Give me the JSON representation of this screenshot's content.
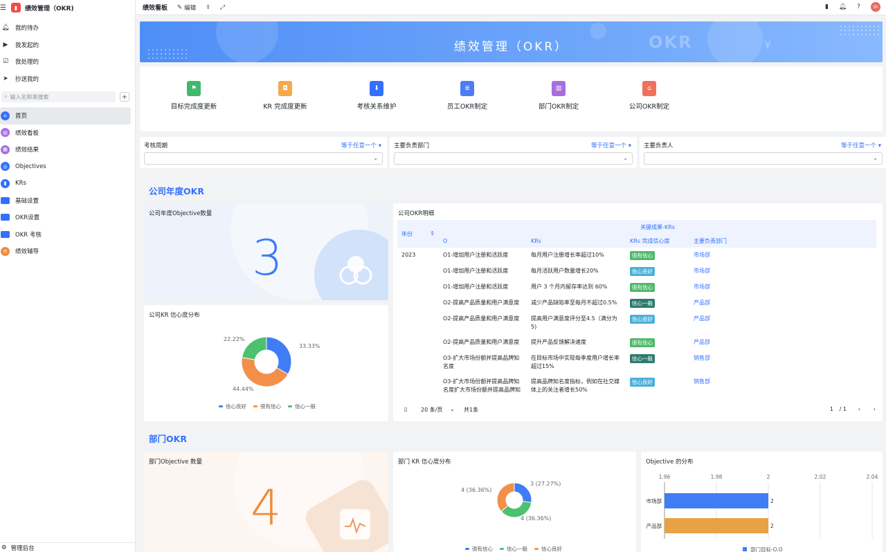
{
  "app": {
    "title": "绩效管理（OKR)",
    "logo_icon": "bookmark-icon"
  },
  "sidebar": {
    "quick": [
      {
        "label": "我的待办",
        "icon": "bell-icon"
      },
      {
        "label": "我发起的",
        "icon": "play-circle-icon"
      },
      {
        "label": "我处理的",
        "icon": "check-square-icon"
      },
      {
        "label": "抄送我的",
        "icon": "send-icon"
      }
    ],
    "search_placeholder": "输入名称来搜索",
    "nav": [
      {
        "label": "首页",
        "icon": "home-icon",
        "color": "#3370ff"
      },
      {
        "label": "绩效看板",
        "icon": "dashboard-icon",
        "color": "#a86ee0"
      },
      {
        "label": "绩效结果",
        "icon": "chart-icon",
        "color": "#a86ee0"
      },
      {
        "label": "Objectives",
        "icon": "target-icon",
        "color": "#3370ff"
      },
      {
        "label": "KRs",
        "icon": "bookmark-icon",
        "color": "#3370ff"
      },
      {
        "label": "基础设置",
        "icon": "folder-icon",
        "color": "#3370ff"
      },
      {
        "label": "OKR设置",
        "icon": "folder-icon",
        "color": "#3370ff"
      },
      {
        "label": "OKR 考核",
        "icon": "folder-icon",
        "color": "#3370ff"
      },
      {
        "label": "绩效辅导",
        "icon": "doc-icon",
        "color": "#f08c3a"
      }
    ],
    "footer": "管理后台"
  },
  "topbar": {
    "title": "绩效看板",
    "edit": "编辑",
    "avatar": "Sh"
  },
  "banner": {
    "title": "绩效管理（OKR）",
    "deco": "OKR"
  },
  "quick_actions": [
    {
      "label": "目标完成度更新",
      "color": "#3fb96b",
      "icon": "flag-icon"
    },
    {
      "label": "KR 完成度更新",
      "color": "#f5a94a",
      "icon": "box-icon"
    },
    {
      "label": "考核关系维护",
      "color": "#3370ff",
      "icon": "download-icon"
    },
    {
      "label": "员工OKR制定",
      "color": "#4c7cf6",
      "icon": "list-icon"
    },
    {
      "label": "部门OKR制定",
      "color": "#a86ee0",
      "icon": "bar-chart-icon"
    },
    {
      "label": "公司OKR制定",
      "color": "#f0715b",
      "icon": "building-icon"
    }
  ],
  "filters": [
    {
      "label": "考核周期",
      "op": "等于任意一个"
    },
    {
      "label": "主要负责部门",
      "op": "等于任意一个"
    },
    {
      "label": "主要负责人",
      "op": "等于任意一个"
    }
  ],
  "company": {
    "section_title": "公司年度OKR",
    "objective_title": "公司年度Objective数量",
    "objective_count": "3",
    "kr_title": "公司KR 信心度分布",
    "table_title": "公司OKR明细",
    "table": {
      "year_header": "年份",
      "group_header": "关键成果-KRs",
      "columns": [
        "O",
        "KRs",
        "KRs 完成信心度",
        "主要负责部门"
      ],
      "year": "2023",
      "rows": [
        {
          "o": "O1-增加用户注册和活跃度",
          "kr": "每月用户注册增长率超过10%",
          "conf": "很有信心",
          "dept": "市场部"
        },
        {
          "o": "O1-增加用户注册和活跃度",
          "kr": "每月活跃用户数量增长20%",
          "conf": "信心良好",
          "dept": "市场部"
        },
        {
          "o": "O1-增加用户注册和活跃度",
          "kr": "用户 3 个月内留存率达到 60%",
          "conf": "很有信心",
          "dept": "市场部"
        },
        {
          "o": "O2-提高产品质量和用户满意度",
          "kr": "减少产品缺陷率至每月不超过0.5%",
          "conf": "信心一般",
          "dept": "产品部"
        },
        {
          "o": "O2-提高产品质量和用户满意度",
          "kr": "提高用户满意度评分至4.5（满分为5)",
          "conf": "信心良好",
          "dept": "产品部"
        },
        {
          "o": "O2-提高产品质量和用户满意度",
          "kr": "提升产品反馈解决速度",
          "conf": "很有信心",
          "dept": "产品部"
        },
        {
          "o": "O3-扩大市场份额并提高品牌知名度",
          "kr": "在目标市场中实现每季度用户增长率超过15%",
          "conf": "信心一般",
          "dept": "销售部"
        },
        {
          "o": "O3-扩大市场份额并提高品牌知名度扩大市场份额并提高品牌知",
          "kr": "提高品牌知名度指标，例如在社交媒体上的关注者增长50%",
          "conf": "信心良好",
          "dept": "销售部"
        }
      ],
      "conf_colors": {
        "很有信心": "#4fb96b",
        "信心良好": "#4ab0d9",
        "信心一般": "#2f7a6e"
      }
    },
    "pager": {
      "page_size": "20 条/页",
      "total": "共1条",
      "page": "1",
      "pages": "/ 1"
    }
  },
  "dept": {
    "section_title": "部门OKR",
    "objective_title": "部门Objective 数量",
    "objective_count": "4",
    "kr_title": "部门 KR 信心度分布",
    "dist_title": "Objective 的分布"
  },
  "chart_data": [
    {
      "type": "pie",
      "title": "公司KR 信心度分布",
      "categories": [
        "信心良好",
        "很有信心",
        "信心一般"
      ],
      "values": [
        33.33,
        44.44,
        22.22
      ],
      "labels": [
        "33.33%",
        "44.44%",
        "22.22%"
      ],
      "colors": [
        "#3f7cf6",
        "#f2904a",
        "#4cc16e"
      ],
      "legend": "bottom"
    },
    {
      "type": "pie",
      "title": "部门 KR 信心度分布",
      "categories": [
        "很有信心",
        "信心一般",
        "信心良好"
      ],
      "legend_colors": [
        "#3f7cf6",
        "#4cc16e",
        "#f2904a"
      ],
      "slices": [
        {
          "value": 3,
          "label": "3 (27.27%)",
          "color": "#3f7cf6"
        },
        {
          "value": 4,
          "label": "4 (36.36%)",
          "color": "#4cc16e"
        },
        {
          "value": 4,
          "label": "4 (36.36%)",
          "color": "#f2904a"
        }
      ],
      "legend": "bottom"
    },
    {
      "type": "bar",
      "orientation": "horizontal",
      "title": "Objective 的分布",
      "categories": [
        "市场部",
        "产品部"
      ],
      "values": [
        2,
        2
      ],
      "colors": [
        "#3f7cf6",
        "#e9a146"
      ],
      "xlim": [
        1.96,
        2.04
      ],
      "ticks": [
        "1.96",
        "1.98",
        "2",
        "2.02",
        "2.04"
      ],
      "series": [
        {
          "name": "部门目标-O.O"
        }
      ],
      "legend": "bottom"
    }
  ]
}
